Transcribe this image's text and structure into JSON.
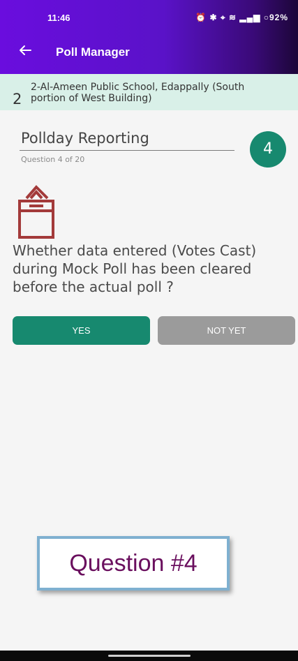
{
  "status_bar": {
    "time": "11:46",
    "icons_text": "⏰ ✱ ⌖ ≣ Wi Ltl Ltl ○ 92%"
  },
  "app_bar": {
    "title": "Poll Manager",
    "back_icon": "back-arrow-icon"
  },
  "station": {
    "number": "2",
    "name": "2-Al-Ameen Public School, Edappally (South portion of West Building)"
  },
  "section": {
    "title": "Pollday Reporting",
    "progress": "Question 4 of 20",
    "badge": "4"
  },
  "question": {
    "icon": "ballot-box-icon",
    "text": "Whether data entered (Votes Cast) during Mock Poll has been cleared before the actual poll ?"
  },
  "answers": {
    "yes_label": "YES",
    "not_yet_label": "NOT YET"
  },
  "callout": {
    "text": "Question #4"
  },
  "colors": {
    "accent": "#17896f",
    "appbar": "#6a0dde",
    "banner": "#d9f0e8",
    "icon": "#a33a3a",
    "secondary_button": "#9b9b9b"
  }
}
